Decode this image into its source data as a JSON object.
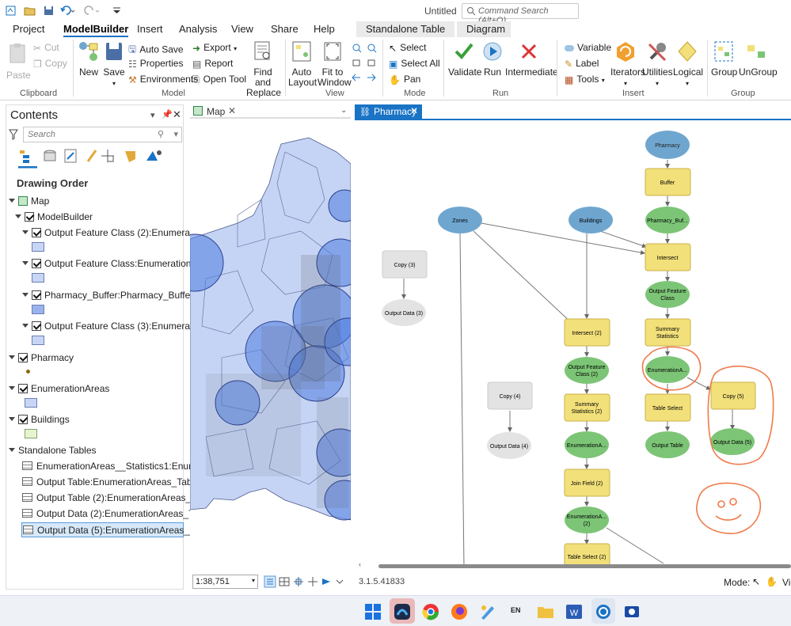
{
  "qat": {
    "doc_title": "Untitled",
    "command_search_placeholder": "Command Search (Alt+Q)"
  },
  "tabs": [
    "Project",
    "ModelBuilder",
    "Insert",
    "Analysis",
    "View",
    "Share",
    "Help"
  ],
  "context_tabs": [
    "Standalone Table",
    "Diagram"
  ],
  "ribbon": {
    "clipboard": {
      "paste": "Paste",
      "cut": "Cut",
      "copy": "Copy",
      "group": "Clipboard"
    },
    "model": {
      "new": "New",
      "save": "Save",
      "auto_save": "Auto Save",
      "properties": "Properties",
      "environments": "Environments",
      "export": "Export",
      "report": "Report",
      "open_tool": "Open Tool",
      "find_replace_1": "Find and",
      "find_replace_2": "Replace",
      "group": "Model"
    },
    "view": {
      "auto_layout_1": "Auto",
      "auto_layout_2": "Layout",
      "fit_window_1": "Fit to",
      "fit_window_2": "Window",
      "group": "View"
    },
    "mode": {
      "select": "Select",
      "select_all": "Select All",
      "pan": "Pan",
      "group": "Mode"
    },
    "run": {
      "validate": "Validate",
      "run": "Run",
      "intermediate": "Intermediate",
      "group": "Run"
    },
    "insert": {
      "variable": "Variable",
      "label": "Label",
      "tools": "Tools",
      "iterators": "Iterators",
      "utilities": "Utilities",
      "logical": "Logical",
      "group": "Insert"
    },
    "group_grp": {
      "group": "Group",
      "ungroup": "UnGroup",
      "label": "Group"
    }
  },
  "contents": {
    "title": "Contents",
    "search_placeholder": "Search",
    "drawing_order": "Drawing Order",
    "map": "Map",
    "modelbuilder": "ModelBuilder",
    "layers_mb": [
      "Output Feature Class (2):EnumerationA...",
      "Output Feature Class:EnumerationArea...",
      "Pharmacy_Buffer:Pharmacy_Buffer1",
      "Output Feature Class (3):EnumerationA..."
    ],
    "pharmacy": "Pharmacy",
    "enumeration_areas": "EnumerationAreas",
    "buildings": "Buildings",
    "standalone_tables": "Standalone Tables",
    "tables": [
      "EnumerationAreas__Statistics1:Enumerat...",
      "Output Table:EnumerationAreas_TableSe...",
      "Output Table (2):EnumerationAreas_Tabl...",
      "Output Data (2):EnumerationAreas_Tabl...",
      "Output Data (5):EnumerationAreas__Stat..."
    ]
  },
  "map_pane": {
    "tab": "Map",
    "scale": "1:38,751"
  },
  "diagram_pane": {
    "tab": "Pharmacy",
    "version": "3.1.5.41833",
    "mode_label": "Mode:",
    "mode_trunc": "Vi"
  },
  "diagram": {
    "nodes": {
      "pharmacy": "Pharmacy",
      "buffer": "Buffer",
      "pharmacy_buf": "Pharmacy_Buf...",
      "zones": "Zones",
      "buildings": "Buildings",
      "intersect": "Intersect",
      "output_fc_1": "Output Feature",
      "output_fc_2": "Class",
      "summary_1": "Summary",
      "summary_2": "Statistics",
      "enum_a": "EnumerationA...",
      "table_select": "Table Select",
      "output_table": "Output Table",
      "copy3": "Copy (3)",
      "output_data3": "Output Data (3)",
      "intersect2": "Intersect (2)",
      "ofc2_1": "Output Feature",
      "ofc2_2": "Class (2)",
      "sum2_1": "Summary",
      "sum2_2": "Statistics (2)",
      "enum_b": "EnumerationA...",
      "join_field2": "Join Field (2)",
      "enum_c_1": "EnumerationA...",
      "enum_c_2": "(2)",
      "table_select2": "Table Select (2)",
      "copy4": "Copy (4)",
      "output_data4": "Output Data (4)",
      "copy5": "Copy (5)",
      "output_data5": "Output Data (5)"
    }
  },
  "colors": {
    "accent": "#1a73c5",
    "tool_yellow": "#f2e07a",
    "data_green": "#7cc576",
    "input_blue": "#6fa6cf",
    "grey_node": "#e3e3e3",
    "annotation": "#f07a4a"
  }
}
